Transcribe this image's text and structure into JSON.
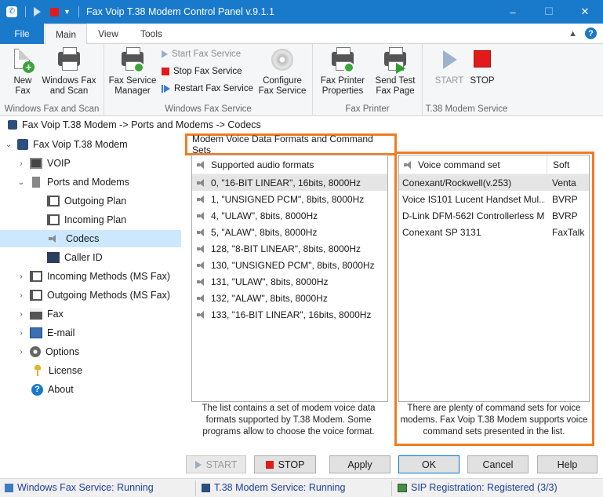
{
  "window": {
    "title": "Fax Voip T.38 Modem Control Panel v.9.1.1",
    "controls": [
      "–",
      "☐",
      "✕"
    ]
  },
  "ribbon_tabs": {
    "file": "File",
    "main": "Main",
    "view": "View",
    "tools": "Tools",
    "help": "?"
  },
  "ribbon": {
    "groups": {
      "windows_fax": {
        "label": "Windows Fax and Scan",
        "new_fax": "New\nFax",
        "windows_fax_scan": "Windows Fax\nand Scan"
      },
      "windows_fax_service": {
        "label": "Windows Fax Service",
        "fax_service_manager": "Fax Service\nManager",
        "start": "Start Fax Service",
        "stop": "Stop Fax Service",
        "restart": "Restart Fax Service",
        "configure": "Configure\nFax Service"
      },
      "fax_printer": {
        "label": "Fax Printer",
        "properties": "Fax Printer\nProperties",
        "send_test": "Send Test\nFax Page"
      },
      "t38": {
        "label": "T.38 Modem Service",
        "start": "START",
        "stop": "STOP"
      }
    }
  },
  "breadcrumb": "Fax Voip T.38 Modem -> Ports and Modems -> Codecs",
  "tree": {
    "root": "Fax Voip T.38 Modem",
    "voip": "VOIP",
    "ports_and_modems": "Ports and Modems",
    "outgoing_plan": "Outgoing Plan",
    "incoming_plan": "Incoming Plan",
    "codecs": "Codecs",
    "caller_id": "Caller ID",
    "incoming_methods": "Incoming Methods (MS Fax)",
    "outgoing_methods": "Outgoing Methods (MS Fax)",
    "fax": "Fax",
    "email": "E-mail",
    "options": "Options",
    "license": "License",
    "about": "About"
  },
  "section_title": "Modem Voice Data Formats and Command Sets",
  "audio_formats": {
    "header": "Supported audio formats",
    "rows": [
      "0, \"16-BIT LINEAR\", 16bits, 8000Hz",
      "1, \"UNSIGNED PCM\", 8bits, 8000Hz",
      "4, \"ULAW\", 8bits, 8000Hz",
      "5, \"ALAW\", 8bits, 8000Hz",
      "128, \"8-BIT LINEAR\", 8bits, 8000Hz",
      "130, \"UNSIGNED PCM\", 8bits, 8000Hz",
      "131, \"ULAW\", 8bits, 8000Hz",
      "132, \"ALAW\", 8bits, 8000Hz",
      "133, \"16-BIT LINEAR\", 16bits, 8000Hz"
    ],
    "description": "The list contains a set of modem voice data formats supported by T.38 Modem. Some programs allow to choose the voice format."
  },
  "command_sets": {
    "header_name": "Voice command set",
    "header_soft": "Soft",
    "rows": [
      {
        "name": "Conexant/Rockwell(v.253)",
        "soft": "Venta"
      },
      {
        "name": "Voice IS101 Lucent Handset Mul...",
        "soft": "BVRP"
      },
      {
        "name": "D-Link DFM-562I Controllerless M",
        "soft": "BVRP"
      },
      {
        "name": "Conexant SP 3131",
        "soft": "FaxTalk"
      }
    ],
    "description": "There are plenty of command sets for voice modems. Fax Voip T.38 Modem supports voice command sets presented in the list."
  },
  "buttons": {
    "start": "START",
    "stop": "STOP",
    "apply": "Apply",
    "ok": "OK",
    "cancel": "Cancel",
    "help": "Help"
  },
  "status": {
    "windows_fax": "Windows Fax Service: Running",
    "t38_modem": "T.38 Modem Service: Running",
    "sip": "SIP Registration: Registered (3/3)"
  },
  "colors": {
    "accent": "#1979ca",
    "highlight_frame": "#f07d21",
    "stop_red": "#e11b1b",
    "selected_row": "#cce8ff"
  }
}
